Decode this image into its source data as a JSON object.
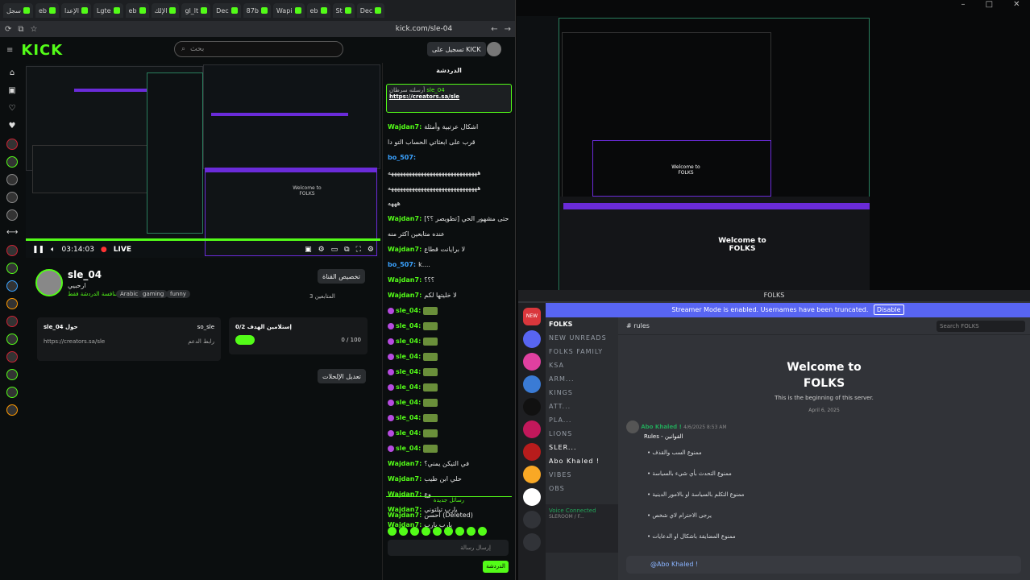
{
  "browser": {
    "tabs": [
      "سجل",
      "eb",
      "الإعدا",
      "Lgte",
      "eb",
      "الإلك",
      "gl_lt",
      "Dec",
      "87b",
      "Wapi",
      "eb",
      "St",
      "Dec"
    ],
    "url": "kick.com/sle-04"
  },
  "kick": {
    "logo": "KICK",
    "search_placeholder": "بحث",
    "login_label": "تسجيل على KICK",
    "video": {
      "time": "03:14:03",
      "live_label": "LIVE"
    },
    "streamer": {
      "name": "sle_04",
      "title": "ارحبيي",
      "category": "منافسة الدردشة فقط",
      "tags": [
        "Arabic",
        "gaming",
        "funny"
      ],
      "follow_label": "تخصيص القناة",
      "followers": "المتابعين 3"
    },
    "about": {
      "handle": "sle_04 حول",
      "label": "حول",
      "social": "so_sle",
      "link_label": "رابط الدعم",
      "link": "https://creators.sa/sle"
    },
    "goal": {
      "title": "إستلامين الهدف 0/2",
      "value": "0 / 100"
    },
    "edit_label": "تعديل الإلحلات"
  },
  "chat": {
    "title": "الدردشة",
    "pinned": {
      "user": "sle_04",
      "by": "أرسلته سرطان",
      "text": "https://creators.sa/sle"
    },
    "messages": [
      {
        "user": "Wajdan7:",
        "color": "#53fc18",
        "text": "اشكال عرتبية وأمثلة"
      },
      {
        "user": "",
        "color": "",
        "text": "قرب على ابعثاتي الحساب التو دا"
      },
      {
        "user": "bo_507:",
        "color": "#3aa2ff",
        "text": ""
      },
      {
        "user": "",
        "color": "",
        "text": "ههههههههههههههههههههههههههههههه"
      },
      {
        "user": "",
        "color": "",
        "text": "ههههههههههههههههههههههههههههههه"
      },
      {
        "user": "",
        "color": "",
        "text": "هههه"
      },
      {
        "user": "Wajdan7:",
        "color": "#53fc18",
        "text": "[تطويصر ؟؟] هذا حتى مشهور الحي"
      },
      {
        "user": "",
        "color": "",
        "text": "عنده متابعين اكثر منه"
      },
      {
        "user": "Wajdan7:",
        "color": "#53fc18",
        "text": "لا برايانت قطاع"
      },
      {
        "user": "bo_507:",
        "color": "#3aa2ff",
        "text": "k...."
      },
      {
        "user": "Wajdan7:",
        "color": "#53fc18",
        "text": "؟؟؟"
      },
      {
        "user": "Wajdan7:",
        "color": "#53fc18",
        "text": "لا خليتها لكم"
      },
      {
        "user": "sle_04:",
        "color": "#53fc18",
        "text": "",
        "emote": true
      },
      {
        "user": "sle_04:",
        "color": "#53fc18",
        "text": "",
        "emote": true
      },
      {
        "user": "sle_04:",
        "color": "#53fc18",
        "text": "",
        "emote": true
      },
      {
        "user": "sle_04:",
        "color": "#53fc18",
        "text": "",
        "emote": true
      },
      {
        "user": "sle_04:",
        "color": "#53fc18",
        "text": "",
        "emote": true
      },
      {
        "user": "sle_04:",
        "color": "#53fc18",
        "text": "",
        "emote": true
      },
      {
        "user": "sle_04:",
        "color": "#53fc18",
        "text": "",
        "emote": true
      },
      {
        "user": "sle_04:",
        "color": "#53fc18",
        "text": "",
        "emote": true
      },
      {
        "user": "sle_04:",
        "color": "#53fc18",
        "text": "",
        "emote": true
      },
      {
        "user": "sle_04:",
        "color": "#53fc18",
        "text": "",
        "emote": true
      },
      {
        "user": "Wajdan7:",
        "color": "#53fc18",
        "text": "في التيكن يمني؟"
      },
      {
        "user": "Wajdan7:",
        "color": "#53fc18",
        "text": "حلي ابن طيب"
      },
      {
        "user": "Wajdan7:",
        "color": "#53fc18",
        "text": "وع"
      },
      {
        "user": "Wajdan7:",
        "color": "#53fc18",
        "text": "يارب تيلتوني"
      },
      {
        "user": "Wajdan7:",
        "color": "#53fc18",
        "text": "يارب يارب"
      }
    ],
    "new_messages_label": "رسائل جديدة",
    "deleted": {
      "user": "Wajdan7:",
      "text": "احسن (Deleted)"
    },
    "input_placeholder": "إرسال رسالة",
    "send_label": "الدردشة"
  },
  "discord": {
    "window_title": "FOLKS",
    "streamer_banner": "Streamer Mode is enabled. Usernames have been truncated.",
    "disable_label": "Disable",
    "server_name": "FOLKS",
    "channel_name": "rules",
    "search_placeholder": "Search FOLKS",
    "welcome_title_line1": "Welcome to",
    "welcome_title_line2": "FOLKS",
    "welcome_sub": "This is the beginning of this server.",
    "welcome_date": "April 6, 2025",
    "channels": [
      "NEW UNREADS",
      "FOLKS FAMILY",
      "KSA",
      "ARM...",
      "KINGS",
      "ATT...",
      "PLA...",
      "LIONS",
      "SLER...",
      "Abo Khaled !",
      "VIBES",
      "OBS"
    ],
    "post": {
      "author": "Abo Khaled !",
      "time": "4/6/2025 8:53 AM",
      "heading": "Rules - القوانين"
    },
    "rules": [
      "ممنوع السب والقذف",
      "ممنوع التحدث بأي شيء بالسياسة",
      "ممنوع التكلم بالسياسة او بالامور الدينية",
      "يرجى الاحترام لاي شخص",
      "ممنوع المضايقة باشكال او الدعايات"
    ],
    "input_value": "@Abo Khaled !",
    "voice_status": "Voice Connected",
    "voice_channel": "SLEROOM / F...",
    "new_badge": "NEW"
  }
}
